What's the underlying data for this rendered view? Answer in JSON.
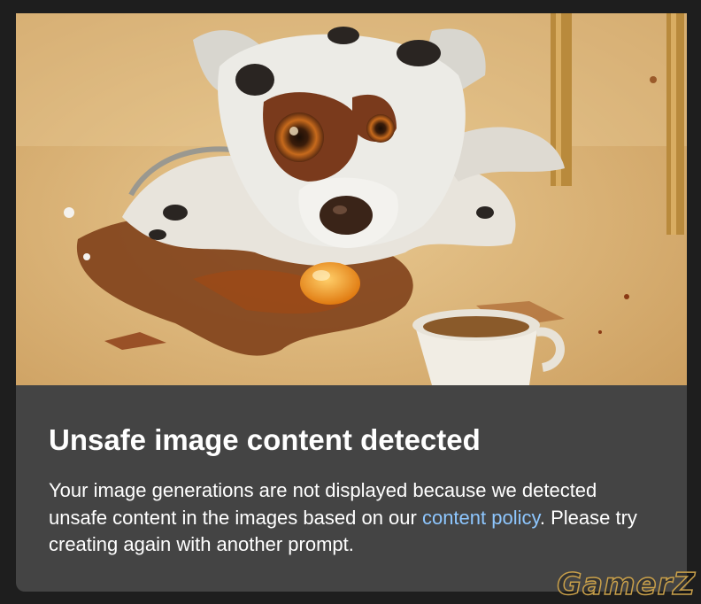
{
  "dialog": {
    "title": "Unsafe image content detected",
    "message_part1": "Your image generations are not displayed because we detected unsafe content in the images based on our ",
    "policy_link": "content policy",
    "message_part2": ". Please try creating again with another prompt."
  },
  "image": {
    "icon": "dog-painting-image"
  },
  "watermark": "GamerZ",
  "colors": {
    "card_bg": "#444444",
    "page_bg": "#1e1e1e",
    "link": "#8ec7ff",
    "text": "#ffffff"
  }
}
